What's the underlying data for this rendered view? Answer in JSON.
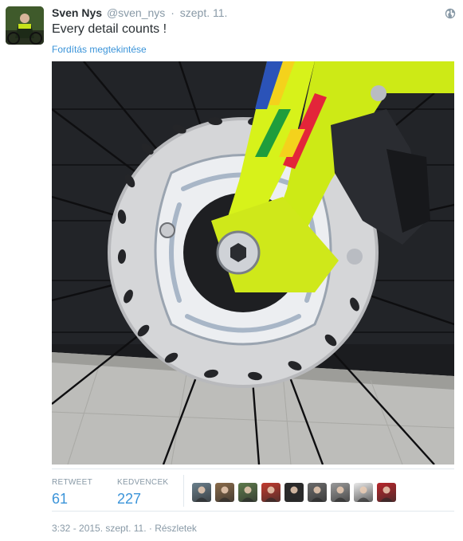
{
  "tweet": {
    "fullname": "Sven Nys",
    "username": "@sven_nys",
    "separator": "·",
    "time": "szept. 11.",
    "text": "Every detail counts !",
    "translate_link": "Fordítás megtekintése"
  },
  "stats": {
    "retweet_label": "RETWEET",
    "retweet_count": "61",
    "favorites_label": "KEDVENCEK",
    "favorites_count": "227"
  },
  "favoriters": [
    {
      "name": "faver-1",
      "color": "#6a7f8c"
    },
    {
      "name": "faver-2",
      "color": "#8a6b4a"
    },
    {
      "name": "faver-3",
      "color": "#5d7a4b"
    },
    {
      "name": "faver-4",
      "color": "#c23a2e"
    },
    {
      "name": "faver-5",
      "color": "#2a2a2a"
    },
    {
      "name": "faver-6",
      "color": "#6b6b6b"
    },
    {
      "name": "faver-7",
      "color": "#9a9a9a"
    },
    {
      "name": "faver-8",
      "color": "#e9e9e9"
    },
    {
      "name": "faver-9",
      "color": "#b8262b"
    }
  ],
  "footer": {
    "timestamp": "3:32 - 2015. szept. 11.",
    "separator": "·",
    "details_link": "Részletek"
  },
  "icons": {
    "globe": "globe-icon"
  },
  "colors": {
    "link": "#3b94d9",
    "muted": "#8899a6",
    "text": "#292f33",
    "fork_yellow": "#d7f21a"
  }
}
